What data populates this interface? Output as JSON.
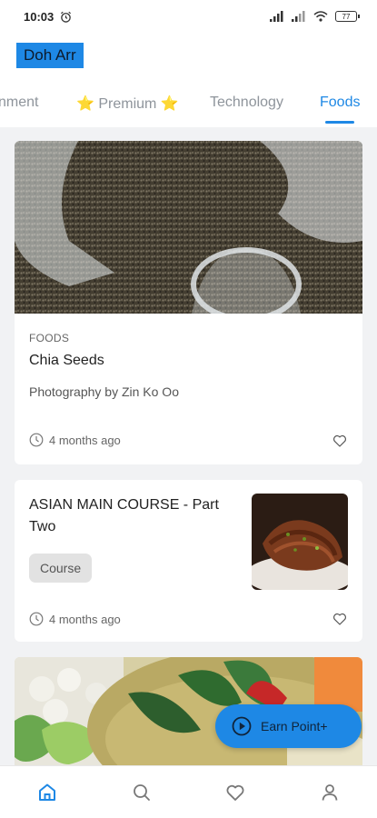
{
  "status_bar": {
    "time": "10:03",
    "battery": "77"
  },
  "header": {
    "title": "Doh Arr"
  },
  "tabs": [
    {
      "label": "nment"
    },
    {
      "label": "⭐ Premium ⭐"
    },
    {
      "label": "Technology"
    },
    {
      "label": "Foods"
    }
  ],
  "cards": [
    {
      "category": "FOODS",
      "title": "Chia Seeds",
      "subtitle": "Photography by Zin Ko Oo",
      "time": "4 months ago"
    },
    {
      "title": "ASIAN MAIN COURSE - Part Two",
      "chip": "Course",
      "time": "4 months ago"
    }
  ],
  "fab": {
    "label": "Earn Point+"
  },
  "colors": {
    "accent": "#1e88e5"
  },
  "bottom_nav": [
    {
      "icon": "home-icon"
    },
    {
      "icon": "search-icon"
    },
    {
      "icon": "heart-icon"
    },
    {
      "icon": "profile-icon"
    }
  ]
}
